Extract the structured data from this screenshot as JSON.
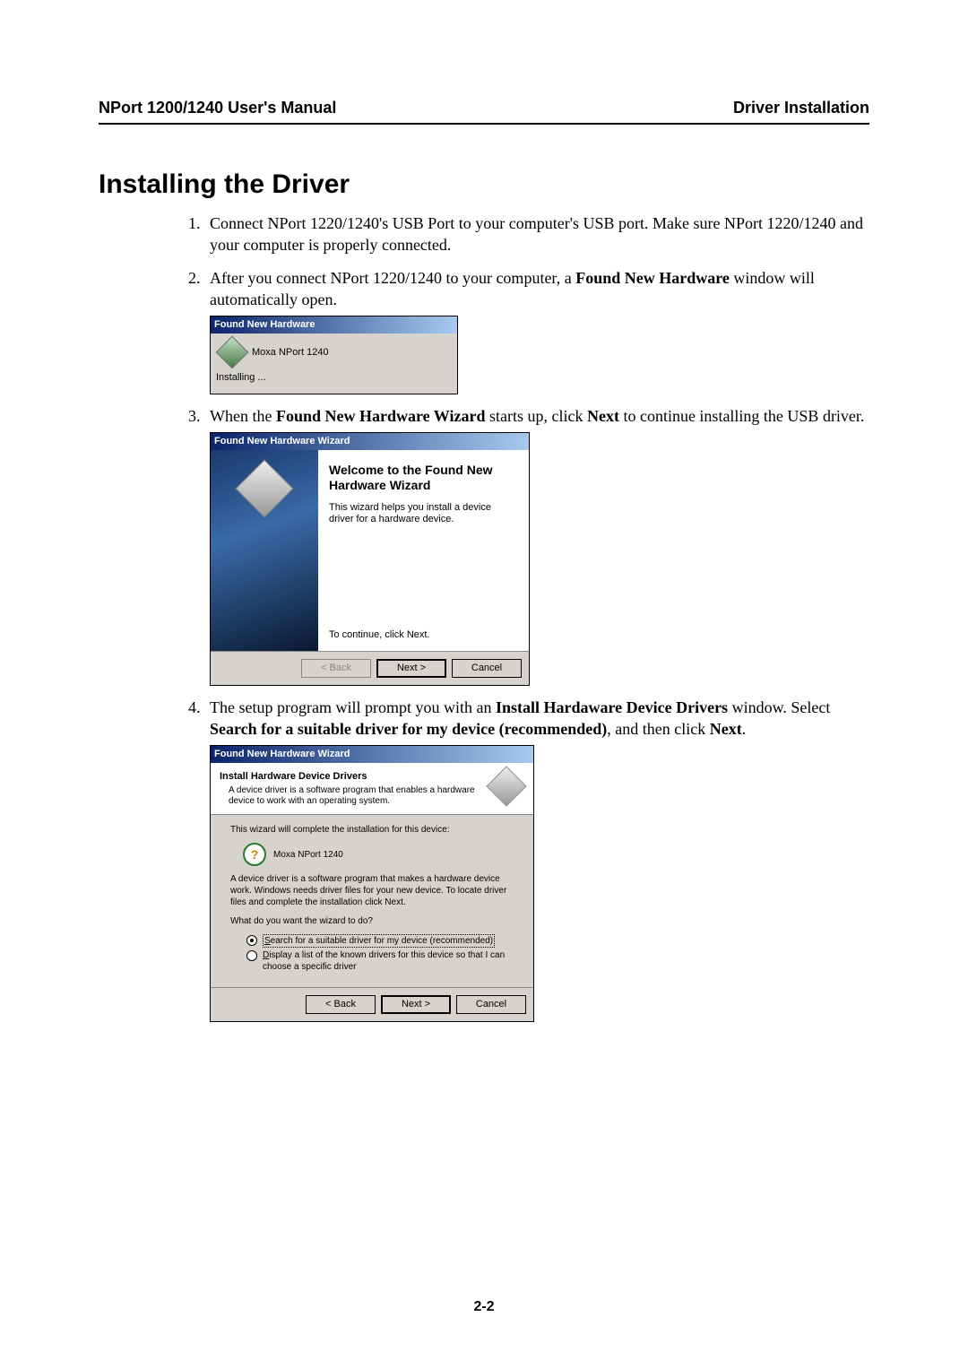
{
  "header": {
    "left": "NPort 1200/1240 User's Manual",
    "right": "Driver Installation"
  },
  "title": "Installing the Driver",
  "steps": {
    "s1": "Connect NPort 1220/1240's USB Port to your computer's USB port. Make sure NPort 1220/1240 and your computer is properly connected.",
    "s2a": "After you connect NPort 1220/1240 to your computer, a ",
    "s2b": "Found New Hardware",
    "s2c": " window will automatically open.",
    "s3a": "When the ",
    "s3b": "Found New Hardware Wizard",
    "s3c": " starts up, click ",
    "s3d": "Next",
    "s3e": " to continue installing the USB driver.",
    "s4a": "The setup program will prompt you with an ",
    "s4b": "Install Hardaware Device Drivers",
    "s4c": " window. Select ",
    "s4d": "Search for a suitable driver for my device (recommended)",
    "s4e": ", and then click ",
    "s4f": "Next",
    "s4g": "."
  },
  "popup_small": {
    "title": "Found New Hardware",
    "device": "Moxa NPort 1240",
    "status": "Installing ..."
  },
  "wizard1": {
    "title": "Found New Hardware Wizard",
    "heading": "Welcome to the Found New Hardware Wizard",
    "text": "This wizard helps you install a device driver for a hardware device.",
    "continue": "To continue, click Next.",
    "back": "< Back",
    "next": "Next >",
    "cancel": "Cancel"
  },
  "wizard2": {
    "title": "Found New Hardware Wizard",
    "head_title": "Install Hardware Device Drivers",
    "head_sub": "A device driver is a software program that enables a hardware device to work with an operating system.",
    "line1": "This wizard will complete the installation for this device:",
    "device": "Moxa NPort 1240",
    "para": "A device driver is a software program that makes a hardware device work. Windows needs driver files for your new device. To locate driver files and complete the installation click Next.",
    "question": "What do you want the wizard to do?",
    "opt1_pre": "S",
    "opt1": "earch for a suitable driver for my device (recommended)",
    "opt2_pre": "D",
    "opt2": "isplay a list of the known drivers for this device so that I can choose a specific driver",
    "back": "< Back",
    "next": "Next >",
    "cancel": "Cancel"
  },
  "page_num": "2-2"
}
